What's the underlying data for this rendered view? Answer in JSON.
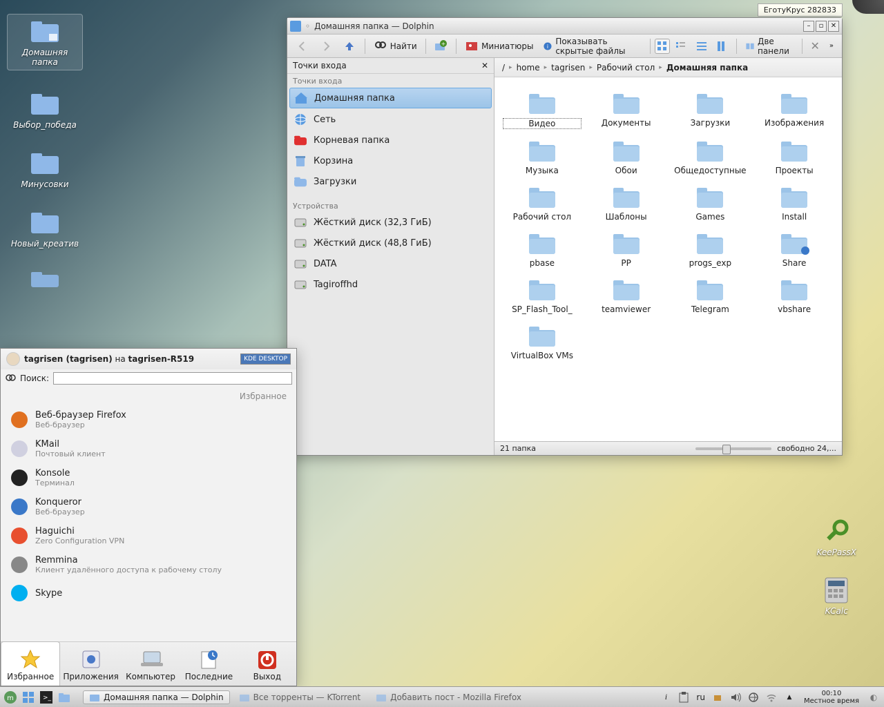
{
  "tooltip": "ЕготуКрус 282833",
  "desktop_icons": [
    {
      "label": "Домашняя папка",
      "selected": true
    },
    {
      "label": "Выбор_победа"
    },
    {
      "label": "Минусовки"
    },
    {
      "label": "Новый_креатив"
    }
  ],
  "right_icons": [
    {
      "label": "KeePassX"
    },
    {
      "label": "KCalc"
    }
  ],
  "dolphin": {
    "title": "Домашняя папка — Dolphin",
    "toolbar": {
      "find": "Найти",
      "thumbnails": "Миниатюры",
      "show_hidden": "Показывать скрытые файлы",
      "two_panels": "Две панели"
    },
    "places_header": "Точки входа",
    "places_section1": "Точки входа",
    "places": [
      {
        "label": "Домашняя папка",
        "icon": "home",
        "selected": true
      },
      {
        "label": "Сеть",
        "icon": "globe"
      },
      {
        "label": "Корневая папка",
        "icon": "redfolder"
      },
      {
        "label": "Корзина",
        "icon": "trash"
      },
      {
        "label": "Загрузки",
        "icon": "folder"
      }
    ],
    "devices_section": "Устройства",
    "devices": [
      {
        "label": "Жёсткий диск (32,3 ГиБ)"
      },
      {
        "label": "Жёсткий диск (48,8 ГиБ)"
      },
      {
        "label": "DATA"
      },
      {
        "label": "Tagiroffhd"
      }
    ],
    "breadcrumb": [
      "/",
      "home",
      "tagrisen",
      "Рабочий стол",
      "Домашняя папка"
    ],
    "files": [
      "Видео",
      "Документы",
      "Загрузки",
      "Изображения",
      "Музыка",
      "Обои",
      "Общедоступные",
      "Проекты",
      "Рабочий стол",
      "Шаблоны",
      "Games",
      "Install",
      "pbase",
      "PP",
      "progs_exp",
      "Share",
      "SP_Flash_Tool_",
      "teamviewer",
      "Telegram",
      "vbshare",
      "VirtualBox VMs"
    ],
    "status_count": "21 папка",
    "status_free": "свободно 24,..."
  },
  "kickoff": {
    "user_bold1": "tagrisen (tagrisen)",
    "user_on": " на ",
    "user_bold2": "tagrisen-R519",
    "badge": "KDE DESKTOP",
    "search_label": "Поиск:",
    "search_value": "",
    "category": "Избранное",
    "apps": [
      {
        "name": "Веб-браузер Firefox",
        "desc": "Веб-браузер",
        "color": "#e07020"
      },
      {
        "name": "KMail",
        "desc": "Почтовый клиент",
        "color": "#d0d0e0"
      },
      {
        "name": "Konsole",
        "desc": "Терминал",
        "color": "#222"
      },
      {
        "name": "Konqueror",
        "desc": "Веб-браузер",
        "color": "#3a78c8"
      },
      {
        "name": "Haguichi",
        "desc": "Zero Configuration VPN",
        "color": "#e85030"
      },
      {
        "name": "Remmina",
        "desc": "Клиент удалённого доступа к рабочему столу",
        "color": "#888"
      },
      {
        "name": "Skype",
        "desc": "",
        "color": "#00aff0"
      }
    ],
    "tabs": [
      {
        "label": "Избранное",
        "icon": "star",
        "active": true
      },
      {
        "label": "Приложения",
        "icon": "apps"
      },
      {
        "label": "Компьютер",
        "icon": "laptop"
      },
      {
        "label": "Последние",
        "icon": "recent"
      },
      {
        "label": "Выход",
        "icon": "power"
      }
    ]
  },
  "taskbar": {
    "tasks": [
      {
        "label": "Домашняя папка — Dolphin",
        "active": true
      },
      {
        "label": "Все торренты — KTorrent",
        "min": true
      },
      {
        "label": "Добавить пост - Mozilla Firefox",
        "min": true
      }
    ],
    "lang": "ru",
    "clock_time": "00:10",
    "clock_label": "Местное время"
  }
}
